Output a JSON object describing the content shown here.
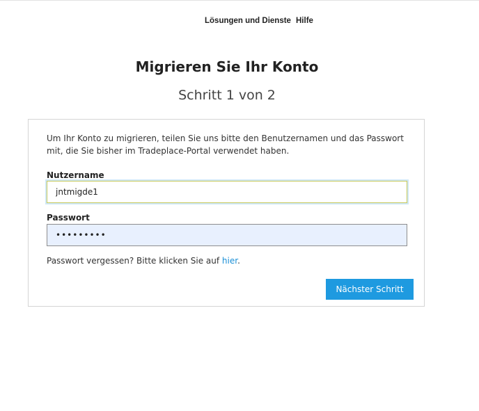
{
  "nav": {
    "solutions_label": "Lösungen und Dienste",
    "help_label": "Hilfe"
  },
  "page": {
    "title": "Migrieren Sie Ihr Konto",
    "step": "Schritt 1 von 2"
  },
  "form": {
    "intro": "Um Ihr Konto zu migrieren, teilen Sie uns bitte den Benutzernamen und das Passwort mit, die Sie bisher im Tradeplace-Portal verwendet haben.",
    "username_label": "Nutzername",
    "username_value": "jntmigde1",
    "password_label": "Passwort",
    "password_value": "•••••••••",
    "forgot_text": "Passwort vergessen? Bitte klicken Sie auf ",
    "forgot_link": "hier",
    "forgot_suffix": ".",
    "next_button": "Nächster Schritt"
  },
  "colors": {
    "accent": "#1e9ae0",
    "link": "#1a8fd6",
    "autofill_bg": "#e8f0fe"
  }
}
